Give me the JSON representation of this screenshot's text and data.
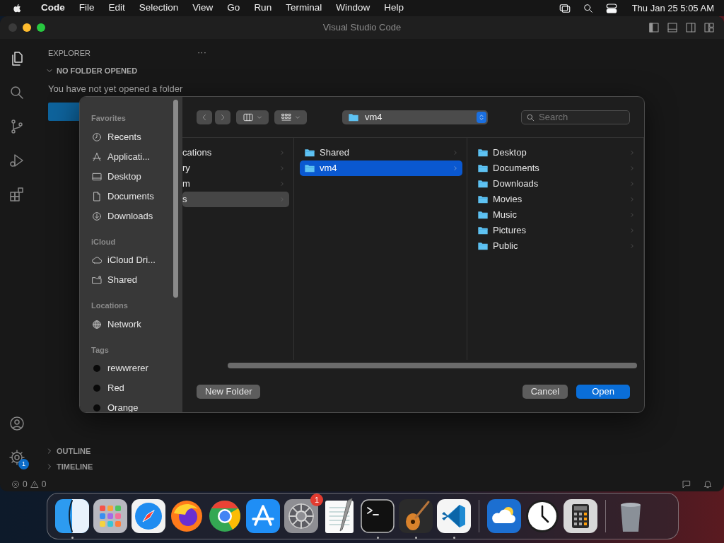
{
  "menubar": {
    "items": [
      {
        "label": "Code",
        "bold": true
      },
      {
        "label": "File",
        "bold": false
      },
      {
        "label": "Edit",
        "bold": false
      },
      {
        "label": "Selection",
        "bold": false
      },
      {
        "label": "View",
        "bold": false
      },
      {
        "label": "Go",
        "bold": false
      },
      {
        "label": "Run",
        "bold": false
      },
      {
        "label": "Terminal",
        "bold": false
      },
      {
        "label": "Window",
        "bold": false
      },
      {
        "label": "Help",
        "bold": false
      }
    ],
    "clock": "Thu Jan 25  5:05 AM"
  },
  "window": {
    "title": "Visual Studio Code"
  },
  "activity_bar": {
    "settings_badge": "1"
  },
  "explorer": {
    "title": "EXPLORER",
    "more": "···",
    "section": "NO FOLDER OPENED",
    "message": "You have not yet opened a folder",
    "panels": [
      {
        "label": "OUTLINE",
        "expanded": false
      },
      {
        "label": "TIMELINE",
        "expanded": false
      }
    ]
  },
  "status_bar": {
    "errors": "0",
    "warnings": "0"
  },
  "dialog": {
    "sidebar": [
      {
        "heading": "Favorites",
        "items": [
          {
            "label": "Recents",
            "kind": "recents"
          },
          {
            "label": "Applicati...",
            "kind": "apps"
          },
          {
            "label": "Desktop",
            "kind": "desktop"
          },
          {
            "label": "Documents",
            "kind": "document"
          },
          {
            "label": "Downloads",
            "kind": "download"
          }
        ]
      },
      {
        "heading": "iCloud",
        "items": [
          {
            "label": "iCloud Dri...",
            "kind": "cloud"
          },
          {
            "label": "Shared",
            "kind": "shared"
          }
        ]
      },
      {
        "heading": "Locations",
        "items": [
          {
            "label": "Network",
            "kind": "network"
          }
        ]
      },
      {
        "heading": "Tags",
        "items": [
          {
            "label": "rewwrerer",
            "kind": "tag"
          },
          {
            "label": "Red",
            "kind": "tag"
          },
          {
            "label": "Orange",
            "kind": "tag"
          }
        ]
      }
    ],
    "path": "vm4",
    "search": {
      "placeholder": "Search"
    },
    "columns": [
      {
        "items": [
          {
            "label": "cations",
            "selected": false
          },
          {
            "label": "ry",
            "selected": false
          },
          {
            "label": "m",
            "selected": false
          },
          {
            "label": "s",
            "selected": true,
            "focused": false
          }
        ]
      },
      {
        "items": [
          {
            "label": "Shared",
            "selected": false
          },
          {
            "label": "vm4",
            "selected": true,
            "focused": true
          }
        ]
      },
      {
        "items": [
          {
            "label": "Desktop",
            "selected": false
          },
          {
            "label": "Documents",
            "selected": false
          },
          {
            "label": "Downloads",
            "selected": false
          },
          {
            "label": "Movies",
            "selected": false
          },
          {
            "label": "Music",
            "selected": false
          },
          {
            "label": "Pictures",
            "selected": false
          },
          {
            "label": "Public",
            "selected": false
          }
        ]
      }
    ],
    "buttons": [
      {
        "label": "New Folder",
        "kind": "secondary"
      },
      {
        "label": "Cancel",
        "kind": "secondary"
      },
      {
        "label": "Open",
        "kind": "primary"
      }
    ]
  },
  "dock": [
    {
      "kind": "finder",
      "running": true
    },
    {
      "kind": "launchpad",
      "running": false
    },
    {
      "kind": "safari",
      "running": false
    },
    {
      "kind": "firefox",
      "running": false
    },
    {
      "kind": "chrome",
      "running": false
    },
    {
      "kind": "appstore",
      "running": false
    },
    {
      "kind": "settings",
      "running": false,
      "badge": "1"
    },
    {
      "kind": "textedit",
      "running": false
    },
    {
      "kind": "terminal",
      "running": true
    },
    {
      "kind": "garageband",
      "running": true
    },
    {
      "kind": "vscode",
      "running": true
    },
    {
      "kind": "separator"
    },
    {
      "kind": "weather",
      "running": false
    },
    {
      "kind": "clock",
      "running": false
    },
    {
      "kind": "calculator",
      "running": false
    },
    {
      "kind": "separator"
    },
    {
      "kind": "trash",
      "running": false
    }
  ]
}
